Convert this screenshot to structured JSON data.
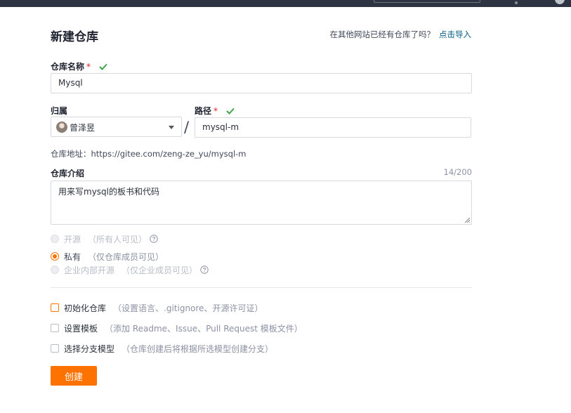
{
  "form": {
    "title": "新建仓库",
    "import_prompt": "在其他网站已经有仓库了吗？",
    "import_link": "点击导入",
    "required_mark": "*",
    "repo_name": {
      "label": "仓库名称",
      "value": "Mysql"
    },
    "owner": {
      "label": "归属",
      "value": "曾泽昱"
    },
    "path_separator": "/",
    "path": {
      "label": "路径",
      "value": "mysql-m"
    },
    "repo_url": "仓库地址：https://gitee.com/zeng-ze_yu/mysql-m",
    "description": {
      "label": "仓库介绍",
      "counter": "14/200",
      "value": "用来写mysql的板书和代码"
    },
    "visibility": [
      {
        "label": "开源",
        "hint": "（所有人可见）",
        "selected": false,
        "disabled": true
      },
      {
        "label": "私有",
        "hint": "（仅仓库成员可见）",
        "selected": true,
        "disabled": false
      },
      {
        "label": "企业内部开源",
        "hint": "（仅企业成员可见）",
        "selected": false,
        "disabled": true
      }
    ],
    "options": [
      {
        "label": "初始化仓库",
        "hint": "（设置语言、.gitignore、开源许可证）",
        "checked": false
      },
      {
        "label": "设置模板",
        "hint": "（添加 Readme、Issue、Pull Request 模板文件）",
        "checked": false
      },
      {
        "label": "选择分支模型",
        "hint": "（仓库创建后将根据所选模型创建分支）",
        "checked": false
      }
    ],
    "submit_label": "创建"
  },
  "colors": {
    "accent": "#fe7300",
    "link": "#005980",
    "valid": "#3ca54b",
    "required": "#e02020"
  },
  "icons": {
    "valid": "check-icon",
    "help": "question-circle-icon",
    "dropdown": "caret-down-icon"
  }
}
